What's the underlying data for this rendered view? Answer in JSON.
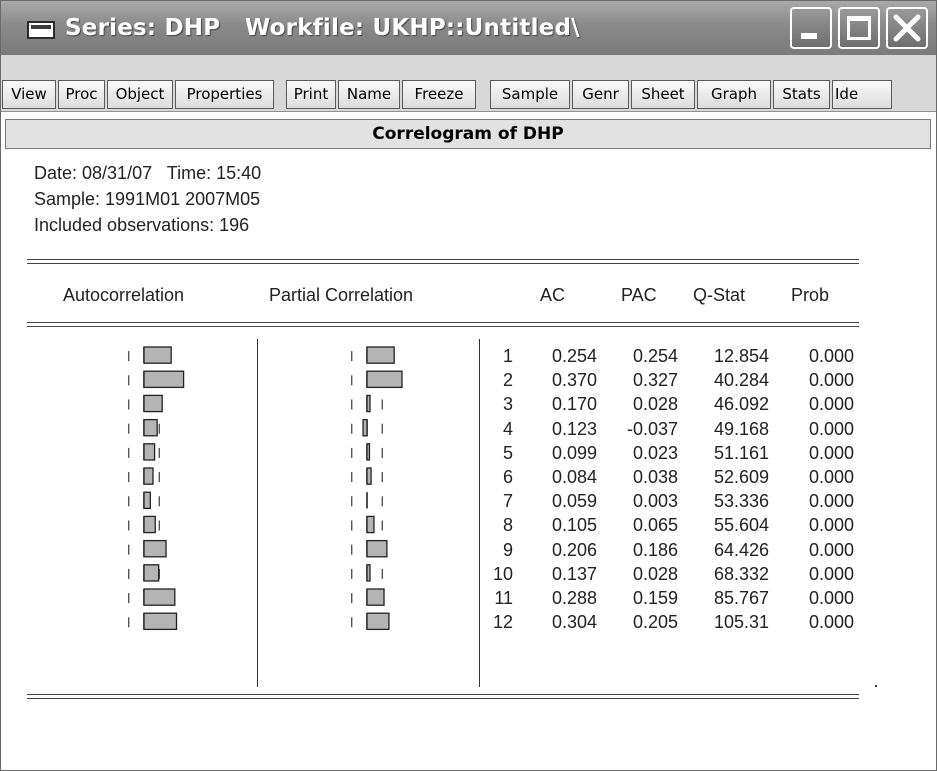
{
  "window": {
    "title": "Series: DHP   Workfile: UKHP::Untitled\\",
    "controls": [
      "minimize",
      "maximize",
      "close"
    ]
  },
  "toolbar": {
    "buttons": [
      "View",
      "Proc",
      "Object",
      "Properties",
      "Print",
      "Name",
      "Freeze",
      "Sample",
      "Genr",
      "Sheet",
      "Graph",
      "Stats",
      "Ide"
    ]
  },
  "view": {
    "header": "Correlogram of DHP",
    "date_line": "Date: 08/31/07   Time: 15:40",
    "sample_line": "Sample: 1991M01 2007M05",
    "obs_line": "Included observations: 196"
  },
  "chart_data": {
    "type": "table",
    "columns": [
      "Autocorrelation",
      "Partial Correlation",
      "",
      "AC",
      "PAC",
      "Q-Stat",
      "Prob"
    ],
    "rows": [
      {
        "lag": "1",
        "ac": "0.254",
        "pac": "0.254",
        "qstat": "12.854",
        "prob": "0.000"
      },
      {
        "lag": "2",
        "ac": "0.370",
        "pac": "0.327",
        "qstat": "40.284",
        "prob": "0.000"
      },
      {
        "lag": "3",
        "ac": "0.170",
        "pac": "0.028",
        "qstat": "46.092",
        "prob": "0.000"
      },
      {
        "lag": "4",
        "ac": "0.123",
        "pac": "-0.037",
        "qstat": "49.168",
        "prob": "0.000"
      },
      {
        "lag": "5",
        "ac": "0.099",
        "pac": "0.023",
        "qstat": "51.161",
        "prob": "0.000"
      },
      {
        "lag": "6",
        "ac": "0.084",
        "pac": "0.038",
        "qstat": "52.609",
        "prob": "0.000"
      },
      {
        "lag": "7",
        "ac": "0.059",
        "pac": "0.003",
        "qstat": "53.336",
        "prob": "0.000"
      },
      {
        "lag": "8",
        "ac": "0.105",
        "pac": "0.065",
        "qstat": "55.604",
        "prob": "0.000"
      },
      {
        "lag": "9",
        "ac": "0.206",
        "pac": "0.186",
        "qstat": "64.426",
        "prob": "0.000"
      },
      {
        "lag": "10",
        "ac": "0.137",
        "pac": "0.028",
        "qstat": "68.332",
        "prob": "0.000"
      },
      {
        "lag": "11",
        "ac": "0.288",
        "pac": "0.159",
        "qstat": "85.767",
        "prob": "0.000"
      },
      {
        "lag": "12",
        "ac": "0.304",
        "pac": "0.205",
        "qstat": "105.31",
        "prob": "0.000"
      }
    ],
    "confidence_band": 0.143,
    "bar_color": "#b4b4b4"
  }
}
